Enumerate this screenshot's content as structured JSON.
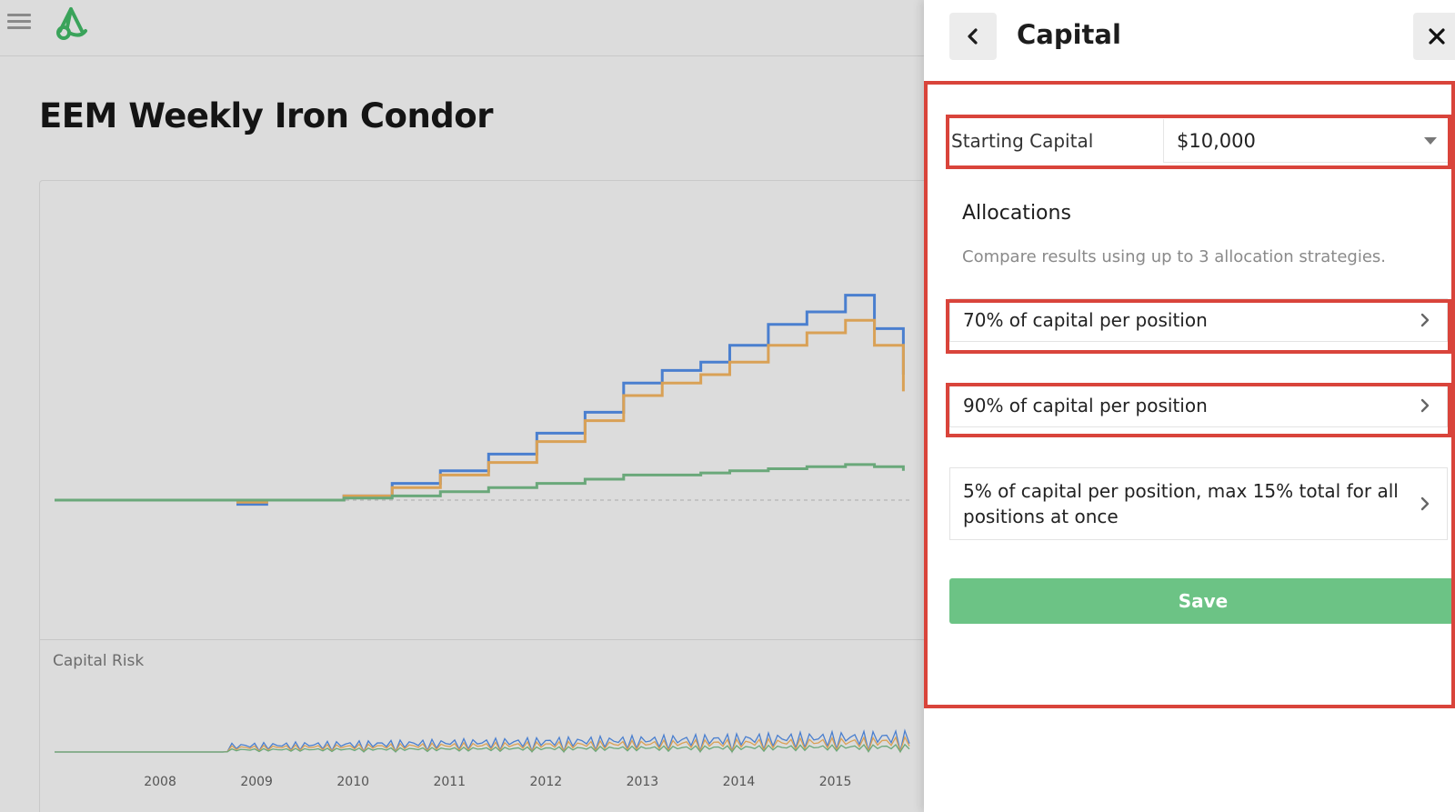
{
  "page": {
    "title": "EEM Weekly Iron Condor",
    "risk_label": "Capital Risk",
    "x_ticks": [
      "2008",
      "2009",
      "2010",
      "2011",
      "2012",
      "2013",
      "2014",
      "2015"
    ]
  },
  "panel": {
    "title": "Capital",
    "back_icon": "chevron-left-icon",
    "close_icon": "close-icon",
    "starting_capital_label": "Starting Capital",
    "starting_capital_value": "$10,000",
    "allocations_title": "Allocations",
    "allocations_desc": "Compare results using up to 3 allocation strategies.",
    "allocations": [
      "70% of capital per position",
      "90% of capital per position",
      "5% of capital per position, max 15% total for all positions at once"
    ],
    "save_label": "Save"
  },
  "colors": {
    "highlight": "#d9443b",
    "save": "#6cc385",
    "series_blue": "#4a7fcf",
    "series_orange": "#d9a156",
    "series_green": "#6aa87a"
  },
  "chart_data": {
    "type": "line",
    "x": [
      2007.0,
      2008.0,
      2008.5,
      2008.9,
      2009.2,
      2009.6,
      2010.0,
      2010.5,
      2011.0,
      2011.5,
      2012.0,
      2012.5,
      2012.9,
      2013.3,
      2013.7,
      2014.0,
      2014.4,
      2014.8,
      2015.2,
      2015.5,
      2015.8
    ],
    "series": [
      {
        "values": [
          0,
          0,
          0,
          -1,
          0,
          0,
          1,
          4,
          7,
          11,
          16,
          21,
          28,
          31,
          33,
          37,
          42,
          45,
          49,
          41,
          30
        ]
      },
      {
        "values": [
          0,
          0,
          0,
          -0.5,
          0,
          0,
          1,
          3,
          6,
          9,
          14,
          19,
          25,
          28,
          30,
          33,
          37,
          40,
          43,
          37,
          26
        ]
      },
      {
        "values": [
          0,
          0,
          0,
          0,
          0,
          0,
          0.5,
          1,
          2,
          3,
          4,
          5,
          6,
          6,
          6.5,
          7,
          7.5,
          8,
          8.5,
          8,
          7
        ]
      }
    ]
  }
}
